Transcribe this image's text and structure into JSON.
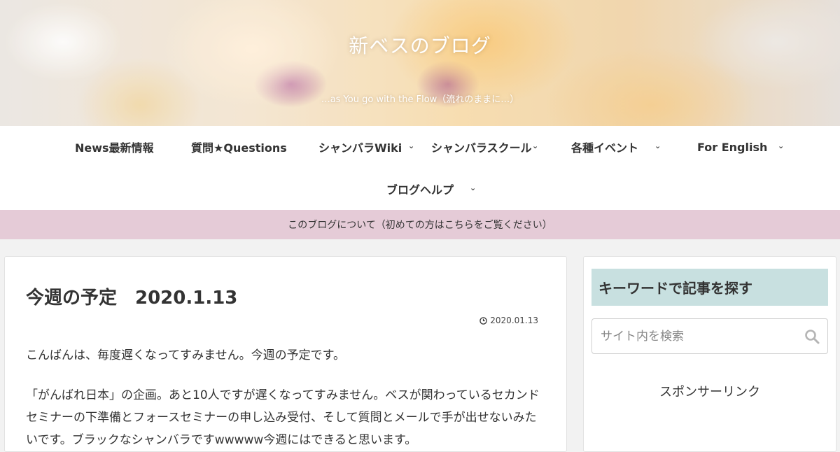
{
  "header": {
    "site_title": "新ベスのブログ",
    "tagline": "…as You go with the Flow（流れのままに…）"
  },
  "nav": {
    "items": [
      {
        "label": "News最新情報",
        "has_dropdown": false
      },
      {
        "label": "質問★Questions",
        "has_dropdown": false
      },
      {
        "label": "シャンバラWiki",
        "has_dropdown": true
      },
      {
        "label": "シャンバラスクール",
        "has_dropdown": true
      },
      {
        "label": "各種イベント",
        "has_dropdown": true
      },
      {
        "label": "For English",
        "has_dropdown": true
      },
      {
        "label": "ブログヘルプ",
        "has_dropdown": true
      }
    ]
  },
  "notice": {
    "text": "このブログについて（初めての方はこちらをご覧ください）",
    "color": "#e5cbd7"
  },
  "article": {
    "title": "今週の予定　2020.1.13",
    "date": "2020.01.13",
    "paragraphs": [
      "こんばんは、毎度遅くなってすみません。今週の予定です。",
      "「がんばれ日本」の企画。あと10人ですが遅くなってすみません。ベスが関わっているセカンドセミナーの下準備とフォースセミナーの申し込み受付、そして質問とメールで手が出せないみたいです。ブラックなシャンバラですwwwww今週にはできると思います。"
    ]
  },
  "sidebar": {
    "widget_title": "キーワードで記事を探す",
    "widget_title_color": "#c8e0e0",
    "search_placeholder": "サイト内を検索",
    "sponsor_label": "スポンサーリンク"
  }
}
